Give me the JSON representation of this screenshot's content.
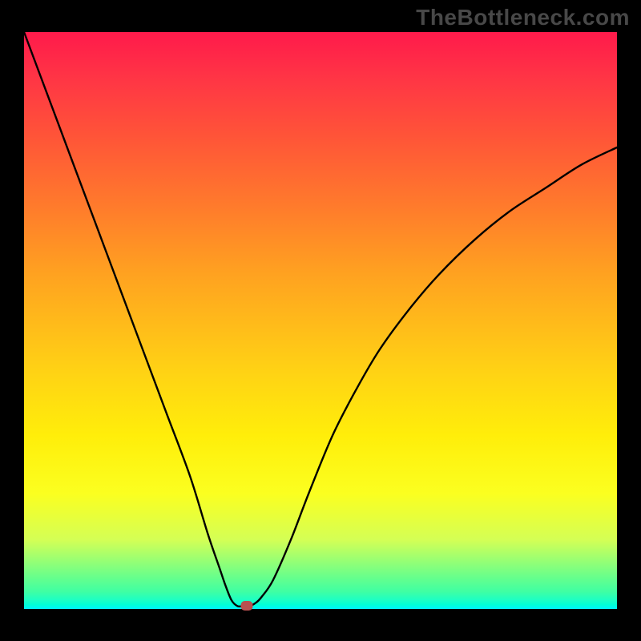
{
  "watermark": "TheBottleneck.com",
  "chart_data": {
    "type": "line",
    "title": "",
    "xlabel": "",
    "ylabel": "",
    "xlim": [
      0,
      100
    ],
    "ylim": [
      0,
      100
    ],
    "series": [
      {
        "name": "curve",
        "x": [
          0,
          4,
          8,
          12,
          16,
          20,
          24,
          28,
          31,
          33,
          34,
          35,
          36,
          37,
          38,
          39,
          40,
          42,
          45,
          48,
          52,
          56,
          60,
          65,
          70,
          76,
          82,
          88,
          94,
          100
        ],
        "values": [
          100,
          89,
          78,
          67,
          56,
          45,
          34,
          23,
          13,
          7,
          4,
          1.5,
          0.5,
          0.5,
          0.5,
          1,
          2,
          5,
          12,
          20,
          30,
          38,
          45,
          52,
          58,
          64,
          69,
          73,
          77,
          80
        ]
      }
    ],
    "marker": {
      "x": 37.5,
      "y": 0.6
    },
    "colors": {
      "curve": "#000000",
      "marker": "#b85050",
      "gradient_top": "#ff1a4b",
      "gradient_mid": "#ffee0a",
      "gradient_bottom": "#00f3ff"
    }
  }
}
